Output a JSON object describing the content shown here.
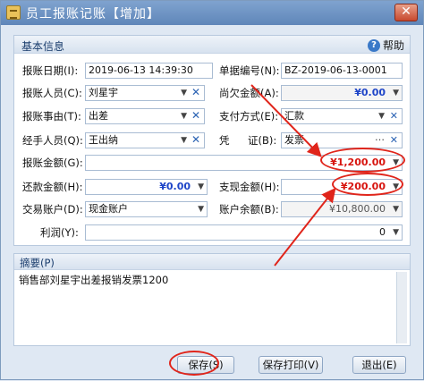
{
  "window": {
    "title": "员工报账记账【增加】",
    "close_glyph": "✕"
  },
  "basic": {
    "header": "基本信息",
    "help_label": "帮助",
    "help_icon": "?"
  },
  "fields": {
    "date": {
      "label": "报账日期(I):",
      "value": "2019-06-13 14:39:30"
    },
    "doc_no": {
      "label": "单据编号(N):",
      "value": "BZ-2019-06-13-0001"
    },
    "person": {
      "label": "报账人员(C):",
      "value": "刘星宇"
    },
    "owed": {
      "label": "尚欠金额(A):",
      "value": "¥0.00"
    },
    "reason": {
      "label": "报账事由(T):",
      "value": "出差"
    },
    "pay_method": {
      "label": "支付方式(E):",
      "value": "汇款"
    },
    "handler": {
      "label": "经手人员(Q):",
      "value": "王出纳"
    },
    "voucher": {
      "label_a": "凭",
      "label_b": "证(B):",
      "value": "发票"
    },
    "amount": {
      "label": "报账金额(G):",
      "value": "¥1,200.00"
    },
    "repay": {
      "label": "还款金额(H):",
      "value": "¥0.00"
    },
    "cash_out": {
      "label": "支现金额(H):",
      "value": "¥200.00"
    },
    "account": {
      "label": "交易账户(D):",
      "value": "现金账户"
    },
    "balance": {
      "label": "账户余额(B):",
      "value": "¥10,800.00"
    },
    "interest": {
      "label": "利润(Y):",
      "value": "0"
    }
  },
  "memo": {
    "header": "摘要(P)",
    "text": "销售部刘星宇出差报销发票1200"
  },
  "buttons": {
    "save": "保存(S)",
    "save_print": "保存打印(V)",
    "exit": "退出(E)"
  },
  "colors": {
    "title_bar": "#6a8fc2",
    "annotation_red": "#e0251b",
    "amount_red": "#d7140e",
    "amount_blue": "#1e45c8"
  }
}
